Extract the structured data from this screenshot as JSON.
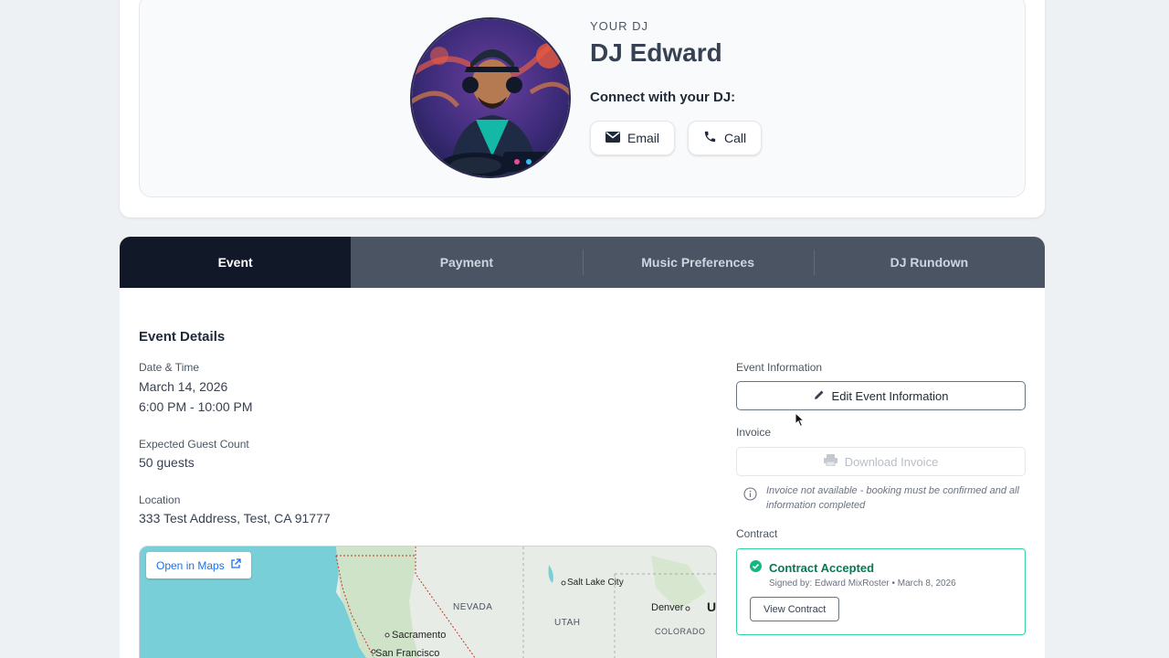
{
  "dj_card": {
    "eyebrow": "YOUR DJ",
    "name": "DJ Edward",
    "connect_label": "Connect with your DJ:",
    "email_label": "Email",
    "call_label": "Call"
  },
  "tabs": [
    {
      "label": "Event",
      "active": true
    },
    {
      "label": "Payment",
      "active": false
    },
    {
      "label": "Music Preferences",
      "active": false
    },
    {
      "label": "DJ Rundown",
      "active": false
    }
  ],
  "event_details": {
    "title": "Event Details",
    "date_time_label": "Date & Time",
    "date": "March 14, 2026",
    "time": "6:00 PM - 10:00 PM",
    "guest_label": "Expected Guest Count",
    "guest_value": "50 guests",
    "location_label": "Location",
    "location_value": "333 Test Address, Test, CA 91777"
  },
  "map": {
    "open_label": "Open in Maps",
    "labels": {
      "nevada": "NEVADA",
      "utah": "UTAH",
      "colorado": "COLORADO",
      "salt_lake": "Salt Lake City",
      "denver": "Denver",
      "sacramento": "Sacramento",
      "san_francisco": "San Francisco",
      "edge": "U"
    }
  },
  "sidebar": {
    "event_info_label": "Event Information",
    "edit_label": "Edit Event Information",
    "invoice_label": "Invoice",
    "download_label": "Download Invoice",
    "invoice_note": "Invoice not available - booking must be confirmed and all information completed",
    "contract_label": "Contract",
    "contract_status": "Contract Accepted",
    "signed_by": "Signed by: Edward MixRoster • March 8, 2026",
    "view_contract_label": "View Contract"
  },
  "colors": {
    "tab_bar": "#4a5463",
    "tab_active": "#111827",
    "success": "#047857",
    "success_border": "#34d399",
    "link_blue": "#1a73e8"
  }
}
